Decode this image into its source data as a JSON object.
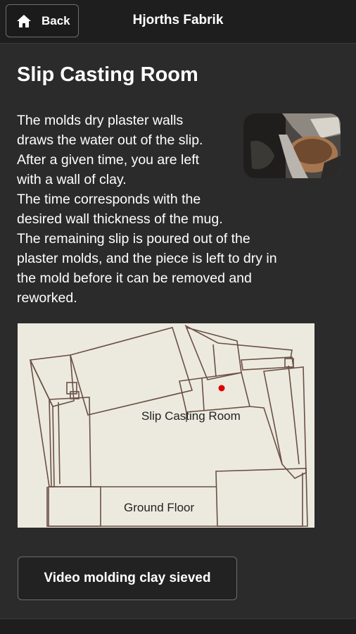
{
  "header": {
    "back_label": "Back",
    "title": "Hjorths Fabrik"
  },
  "page": {
    "title": "Slip Casting Room",
    "body_lines": [
      "The molds dry plaster walls",
      "draws the water out of the slip.",
      "After a given time, you are left",
      "with a wall of clay.",
      "The time corresponds with the",
      "desired wall thickness of the mug.",
      "The remaining slip is poured out of the",
      "plaster molds, and the piece is left to dry in",
      "the mold before it can be removed and",
      "reworked."
    ]
  },
  "floor_plan": {
    "room_label": "Slip Casting Room",
    "floor_label": "Ground Floor",
    "marker_color": "#e00000",
    "background_color": "#eceadf"
  },
  "video_button_label": "Video molding clay sieved",
  "icons": {
    "back": "home-icon"
  }
}
